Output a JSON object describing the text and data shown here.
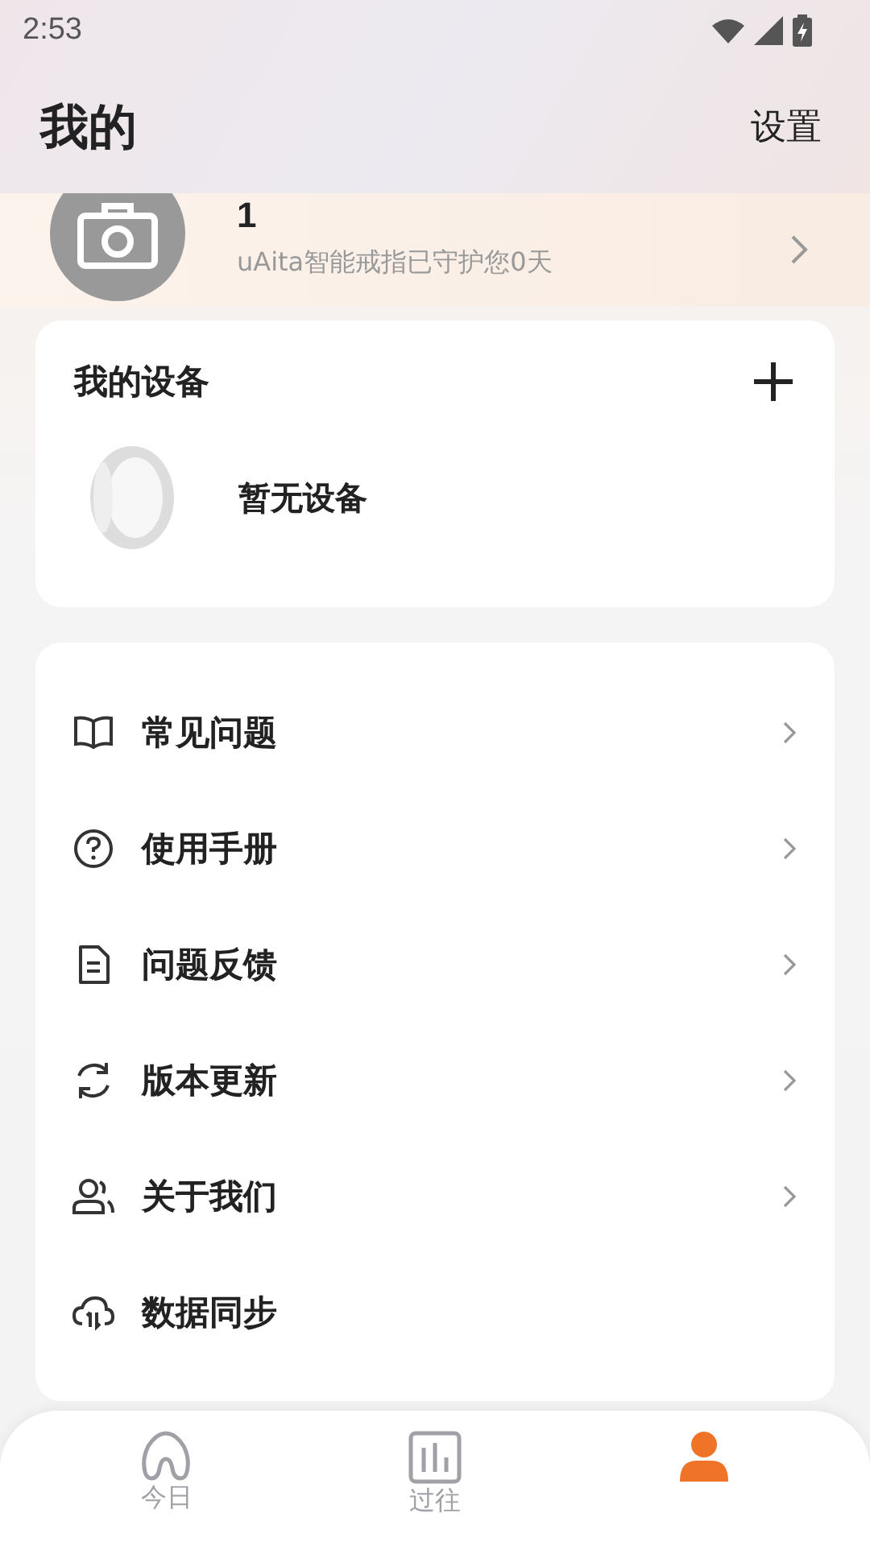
{
  "status_bar": {
    "time": "2:53"
  },
  "header": {
    "title": "我的",
    "action": "设置"
  },
  "profile": {
    "name": "1",
    "subtitle": "uAita智能戒指已守护您0天"
  },
  "devices": {
    "title": "我的设备",
    "empty_text": "暂无设备"
  },
  "menu": [
    {
      "label": "常见问题",
      "chevron": true
    },
    {
      "label": "使用手册",
      "chevron": true
    },
    {
      "label": "问题反馈",
      "chevron": true
    },
    {
      "label": "版本更新",
      "chevron": true
    },
    {
      "label": "关于我们",
      "chevron": true
    },
    {
      "label": "数据同步",
      "chevron": false
    }
  ],
  "tabs": [
    {
      "label": "今日",
      "selected": false
    },
    {
      "label": "过往",
      "selected": false
    },
    {
      "selected": true
    }
  ]
}
